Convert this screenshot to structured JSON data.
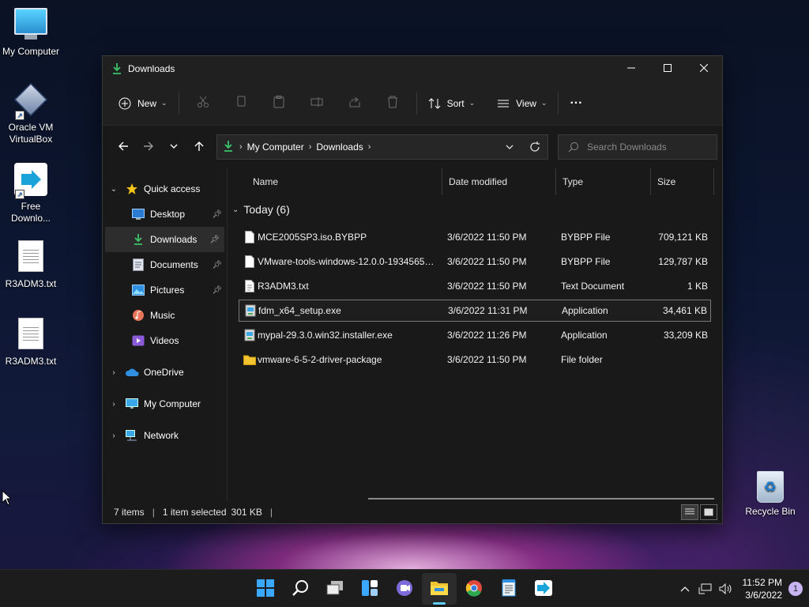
{
  "desktop": {
    "icons": [
      {
        "label": "My Computer",
        "icon": "monitor-icon"
      },
      {
        "label": "Oracle VM VirtualBox",
        "icon": "virtualbox-icon"
      },
      {
        "label": "Free Downlo...",
        "icon": "free-download-manager-icon"
      },
      {
        "label": "R3ADM3.txt",
        "icon": "text-file-icon"
      },
      {
        "label": "R3ADM3.txt",
        "icon": "text-file-icon"
      }
    ],
    "recycle_bin": {
      "label": "Recycle Bin",
      "icon": "recycle-bin-icon"
    }
  },
  "window": {
    "title": "Downloads",
    "controls": {
      "minimize": "minimize-icon",
      "maximize": "maximize-icon",
      "close": "close-icon"
    }
  },
  "toolbar": {
    "new_label": "New",
    "sort_label": "Sort",
    "view_label": "View",
    "more_label": "···"
  },
  "address": {
    "crumbs": [
      "My Computer",
      "Downloads"
    ],
    "search_placeholder": "Search Downloads"
  },
  "sidebar": {
    "quick_access": "Quick access",
    "items": [
      {
        "label": "Desktop",
        "pinned": true
      },
      {
        "label": "Downloads",
        "pinned": true,
        "selected": true
      },
      {
        "label": "Documents",
        "pinned": true
      },
      {
        "label": "Pictures",
        "pinned": true
      },
      {
        "label": "Music",
        "pinned": false
      },
      {
        "label": "Videos",
        "pinned": false
      }
    ],
    "onedrive": "OneDrive",
    "my_computer": "My Computer",
    "network": "Network"
  },
  "columns": {
    "name": "Name",
    "date": "Date modified",
    "type": "Type",
    "size": "Size"
  },
  "group": {
    "label": "Today (6)"
  },
  "files": [
    {
      "name": "MCE2005SP3.iso.BYBPP",
      "date": "3/6/2022 11:50 PM",
      "type": "BYBPP File",
      "size": "709,121 KB",
      "icon": "generic-file-icon"
    },
    {
      "name": "VMware-tools-windows-12.0.0-19345655....",
      "date": "3/6/2022 11:50 PM",
      "type": "BYBPP File",
      "size": "129,787 KB",
      "icon": "generic-file-icon"
    },
    {
      "name": "R3ADM3.txt",
      "date": "3/6/2022 11:50 PM",
      "type": "Text Document",
      "size": "1 KB",
      "icon": "text-file-icon"
    },
    {
      "name": "fdm_x64_setup.exe",
      "date": "3/6/2022 11:31 PM",
      "type": "Application",
      "size": "34,461 KB",
      "icon": "installer-icon"
    },
    {
      "name": "mypal-29.3.0.win32.installer.exe",
      "date": "3/6/2022 11:26 PM",
      "type": "Application",
      "size": "33,209 KB",
      "icon": "installer-icon"
    },
    {
      "name": "vmware-6-5-2-driver-package",
      "date": "3/6/2022 11:50 PM",
      "type": "File folder",
      "size": "",
      "icon": "folder-icon"
    }
  ],
  "status": {
    "items": "7 items",
    "selected": "1 item selected",
    "size": "301 KB",
    "divider": "|"
  },
  "taskbar": {
    "apps": [
      "start-icon",
      "search-icon",
      "task-view-icon",
      "widgets-icon",
      "chat-icon",
      "file-explorer-icon",
      "chrome-icon",
      "notepad-icon",
      "free-download-manager-icon"
    ],
    "time": "11:52 PM",
    "date": "3/6/2022",
    "notifications": "1"
  }
}
